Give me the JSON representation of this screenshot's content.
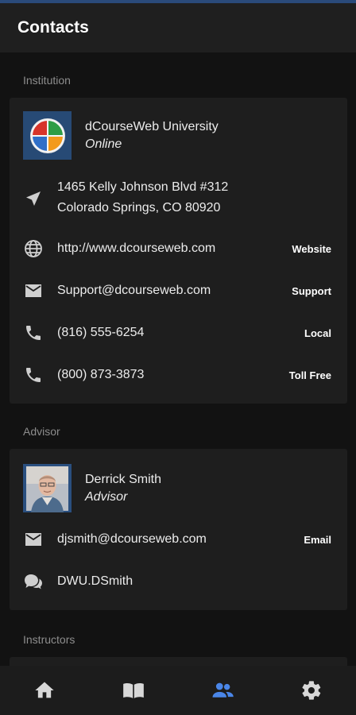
{
  "app_bar": {
    "title": "Contacts"
  },
  "colors": {
    "accent": "#4a86e8",
    "icon": "#cfcfcf",
    "nav_icon": "#d8d8d8"
  },
  "institution": {
    "section_label": "Institution",
    "name": "dCourseWeb University",
    "subtitle": "Online",
    "logo_icon": "dcourseweb-logo",
    "address_line1": "1465 Kelly Johnson Blvd #312",
    "address_line2": "Colorado Springs, CO 80920",
    "website": {
      "value": "http://www.dcourseweb.com",
      "action": "Website"
    },
    "support": {
      "value": "Support@dcourseweb.com",
      "action": "Support"
    },
    "local_phone": {
      "value": "(816) 555-6254",
      "action": "Local"
    },
    "tollfree_phone": {
      "value": "(800) 873-3873",
      "action": "Toll Free"
    }
  },
  "advisor": {
    "section_label": "Advisor",
    "name": "Derrick Smith",
    "subtitle": "Advisor",
    "email": {
      "value": "djsmith@dcourseweb.com",
      "action": "Email"
    },
    "chat": {
      "value": "DWU.DSmith"
    }
  },
  "instructors": {
    "section_label": "Instructors"
  },
  "bottom_nav": [
    {
      "icon": "home-icon",
      "active": false
    },
    {
      "icon": "book-icon",
      "active": false
    },
    {
      "icon": "people-icon",
      "active": true
    },
    {
      "icon": "settings-icon",
      "active": false
    }
  ]
}
